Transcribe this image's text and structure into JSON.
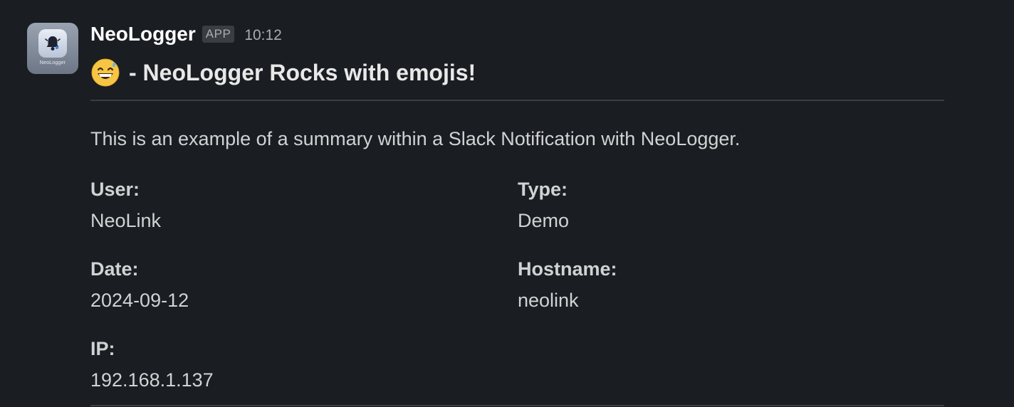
{
  "sender": {
    "name": "NeoLogger",
    "badge": "APP",
    "time": "10:12",
    "avatar_label": "NeoLogger",
    "avatar_icon": "bell-icon"
  },
  "message": {
    "emoji": "grinning-face-with-sweat-emoji",
    "title": "- NeoLogger Rocks with emojis!",
    "summary": "This is an example of a summary within a Slack Notification with NeoLogger."
  },
  "fields": {
    "user": {
      "label": "User:",
      "value": "NeoLink"
    },
    "type": {
      "label": "Type:",
      "value": "Demo"
    },
    "date": {
      "label": "Date:",
      "value": "2024-09-12"
    },
    "hostname": {
      "label": "Hostname:",
      "value": "neolink"
    },
    "ip": {
      "label": "IP:",
      "value": "192.168.1.137"
    }
  },
  "colors": {
    "background": "#1a1d21",
    "text": "#d1d2d3",
    "title": "#ffffff",
    "muted": "#abacad",
    "divider": "#3a3d42"
  }
}
